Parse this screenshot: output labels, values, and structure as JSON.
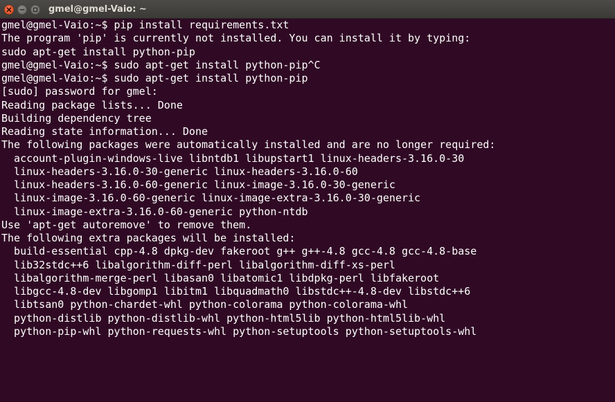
{
  "window": {
    "title": "gmel@gmel-Vaio: ~"
  },
  "terminal": {
    "lines": [
      "gmel@gmel-Vaio:~$ pip install requirements.txt",
      "The program 'pip' is currently not installed. You can install it by typing:",
      "sudo apt-get install python-pip",
      "gmel@gmel-Vaio:~$ sudo apt-get install python-pip^C",
      "gmel@gmel-Vaio:~$ sudo apt-get install python-pip",
      "[sudo] password for gmel:",
      "Reading package lists... Done",
      "Building dependency tree",
      "Reading state information... Done",
      "The following packages were automatically installed and are no longer required:",
      "  account-plugin-windows-live libntdb1 libupstart1 linux-headers-3.16.0-30",
      "  linux-headers-3.16.0-30-generic linux-headers-3.16.0-60",
      "  linux-headers-3.16.0-60-generic linux-image-3.16.0-30-generic",
      "  linux-image-3.16.0-60-generic linux-image-extra-3.16.0-30-generic",
      "  linux-image-extra-3.16.0-60-generic python-ntdb",
      "Use 'apt-get autoremove' to remove them.",
      "The following extra packages will be installed:",
      "  build-essential cpp-4.8 dpkg-dev fakeroot g++ g++-4.8 gcc-4.8 gcc-4.8-base",
      "  lib32stdc++6 libalgorithm-diff-perl libalgorithm-diff-xs-perl",
      "  libalgorithm-merge-perl libasan0 libatomic1 libdpkg-perl libfakeroot",
      "  libgcc-4.8-dev libgomp1 libitm1 libquadmath0 libstdc++-4.8-dev libstdc++6",
      "  libtsan0 python-chardet-whl python-colorama python-colorama-whl",
      "  python-distlib python-distlib-whl python-html5lib python-html5lib-whl",
      "  python-pip-whl python-requests-whl python-setuptools python-setuptools-whl"
    ]
  },
  "icons": {
    "close": "close-icon",
    "minimize": "minimize-icon",
    "maximize": "maximize-icon"
  },
  "colors": {
    "background": "#300a24",
    "text": "#ffffff",
    "titlebar": "#3c3b37",
    "close_button": "#e95420"
  }
}
